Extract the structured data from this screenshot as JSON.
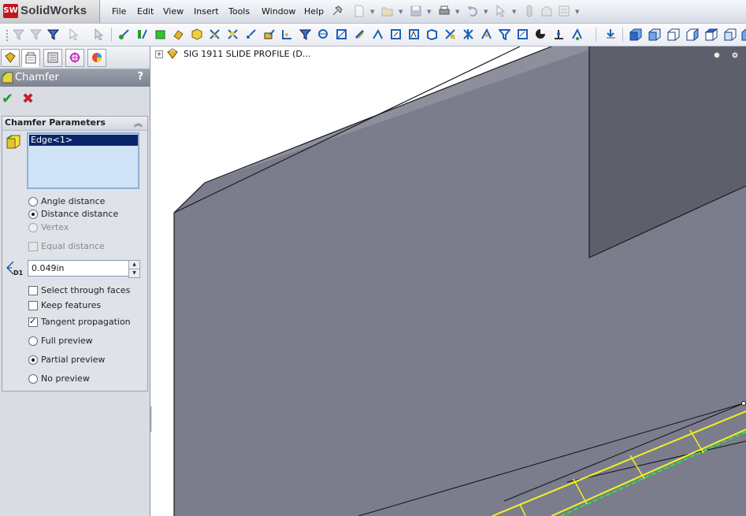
{
  "app": {
    "logo_badge": "SW",
    "name": "SolidWorks"
  },
  "menu": [
    "File",
    "Edit",
    "View",
    "Insert",
    "Tools",
    "Window",
    "Help"
  ],
  "feature_tree": {
    "root_label": "SIG 1911 SLIDE PROFILE  (D...",
    "expander": "+"
  },
  "property_manager": {
    "title": "Chamfer",
    "help": "?",
    "ok_symbol": "✔",
    "cancel_symbol": "✖",
    "group_title": "Chamfer Parameters",
    "collapse_symbol": "︽",
    "selection_item": "Edge<1>",
    "chamfer_type_options": [
      {
        "label": "Angle distance",
        "selected": false,
        "enabled": true
      },
      {
        "label": "Distance distance",
        "selected": true,
        "enabled": true
      },
      {
        "label": "Vertex",
        "selected": false,
        "enabled": false
      }
    ],
    "equal_distance": {
      "label": "Equal distance",
      "checked": false,
      "enabled": false
    },
    "distance_label": "D1",
    "distance_value": "0.049in",
    "spin_up": "▲",
    "spin_down": "▼",
    "options": [
      {
        "label": "Select through faces",
        "checked": false
      },
      {
        "label": "Keep features",
        "checked": false
      },
      {
        "label": "Tangent propagation",
        "checked": true
      }
    ],
    "preview_options": [
      {
        "label": "Full preview",
        "selected": false
      },
      {
        "label": "Partial preview",
        "selected": true
      },
      {
        "label": "No preview",
        "selected": false
      }
    ]
  },
  "colors": {
    "model_face": "#7b7d8c",
    "model_face_dark": "#5d5f6b",
    "edge": "#1b1b1f",
    "preview_yellow": "#f2f223",
    "preview_green": "#27e34a",
    "ok_green": "#1f9a2a",
    "cancel_red": "#c8202a"
  }
}
